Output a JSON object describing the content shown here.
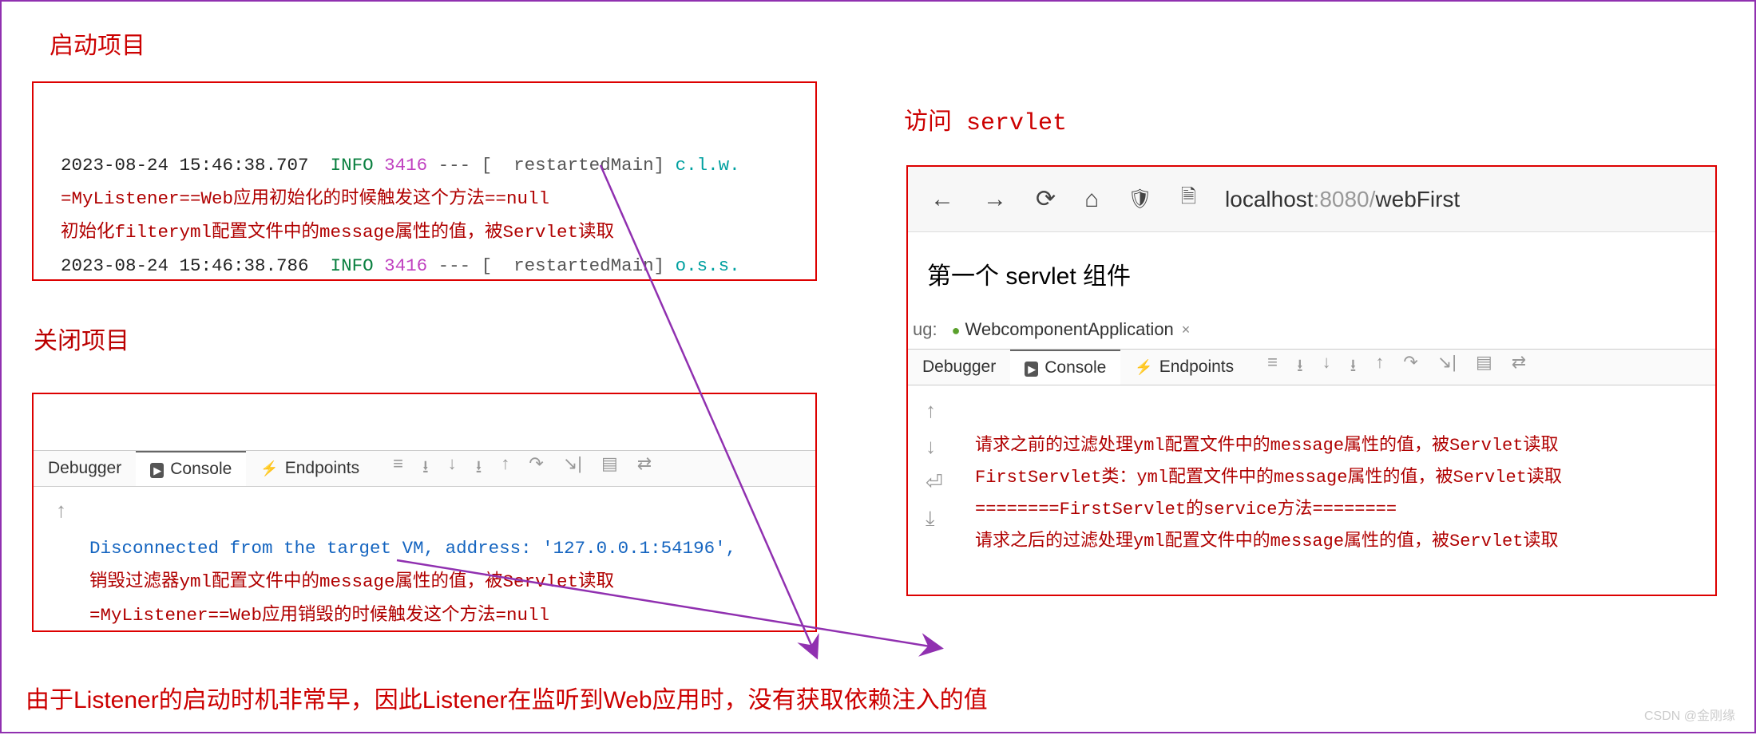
{
  "titles": {
    "start": "启动项目",
    "close": "关闭项目",
    "visit": "访问 servlet"
  },
  "footnote": "由于Listener的启动时机非常早，因此Listener在监听到Web应用时，没有获取依赖注入的值",
  "watermark": "CSDN @金刚缘",
  "start_log": {
    "line1": {
      "ts": "2023-08-24 15:46:38.707 ",
      "level": " INFO ",
      "pid": "3416",
      "rest": " --- [  restartedMain] ",
      "cls": "c.l.w."
    },
    "line2": "=MyListener==Web应用初始化的时候触发这个方法==null",
    "line3": "初始化filteryml配置文件中的message属性的值，被Servlet读取",
    "line4": {
      "ts": "2023-08-24 15:46:38.786 ",
      "level": " INFO ",
      "pid": "3416",
      "rest": " --- [  restartedMain] ",
      "cls": "o.s.s."
    }
  },
  "close_log": {
    "line1": "Disconnected from the target VM, address: '127.0.0.1:54196',",
    "line2": "销毁过滤器yml配置文件中的message属性的值，被Servlet读取",
    "line3": "=MyListener==Web应用销毁的时候触发这个方法=null"
  },
  "tabs": {
    "debugger": "Debugger",
    "console": "Console",
    "endpoints": "Endpoints"
  },
  "toolbar_icons": [
    "≡",
    "⭳",
    "↓",
    "⭳",
    "↑",
    "↷",
    "↘|",
    "▤",
    "⇄"
  ],
  "browser": {
    "url_host": "localhost",
    "url_port": ":8080/",
    "url_path": "webFirst",
    "page_title": "第一个 servlet 组件"
  },
  "debug_header": {
    "label_prefix": "ug:",
    "app": "WebcomponentApplication"
  },
  "visit_log": {
    "line1": "请求之前的过滤处理yml配置文件中的message属性的值，被Servlet读取",
    "line2": "FirstServlet类：yml配置文件中的message属性的值，被Servlet读取",
    "line3": "========FirstServlet的service方法========",
    "line4": "请求之后的过滤处理yml配置文件中的message属性的值，被Servlet读取"
  }
}
